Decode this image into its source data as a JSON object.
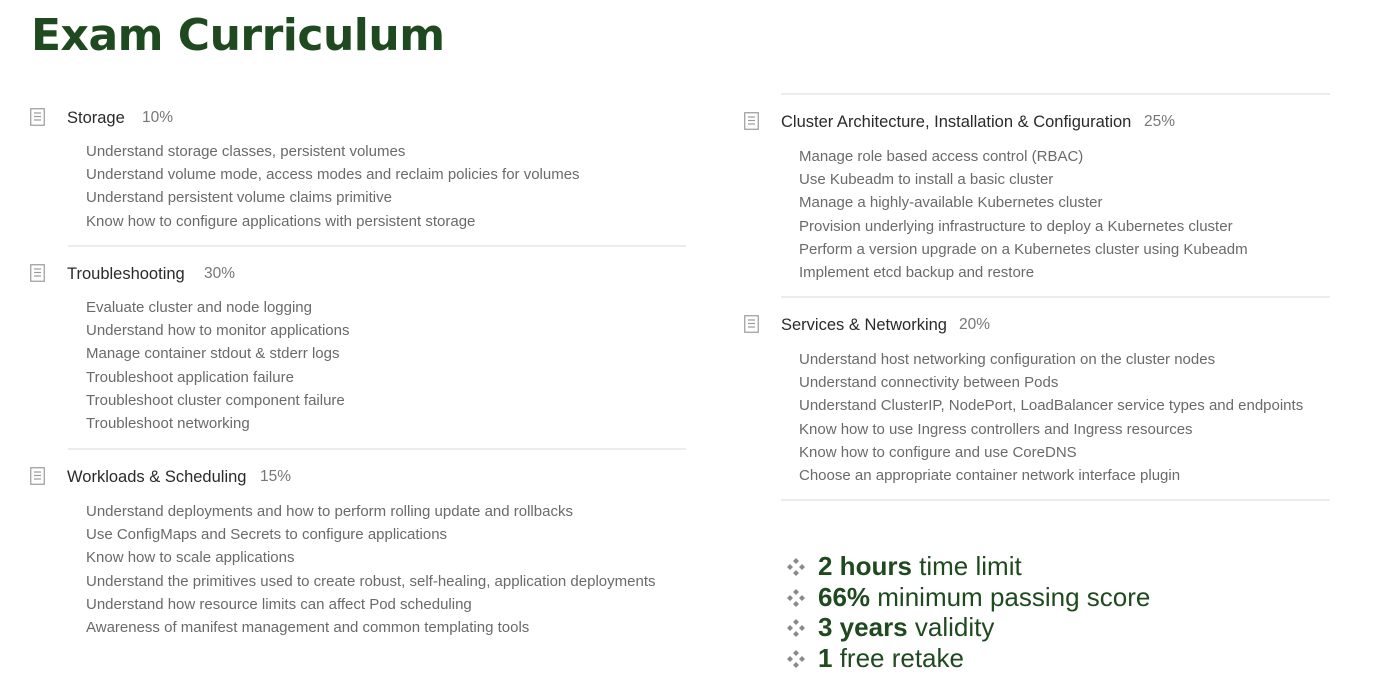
{
  "title": "Exam Curriculum",
  "left_sections": [
    {
      "title": "Storage",
      "weight": "10%",
      "items": [
        "Understand storage classes, persistent volumes",
        "Understand volume mode, access modes and reclaim policies for volumes",
        "Understand persistent volume claims primitive",
        "Know how to configure applications with persistent storage"
      ]
    },
    {
      "title": "Troubleshooting",
      "weight": "30%",
      "items": [
        "Evaluate cluster and node logging",
        "Understand how to monitor applications",
        "Manage container stdout & stderr logs",
        "Troubleshoot application failure",
        "Troubleshoot cluster component failure",
        "Troubleshoot networking"
      ]
    },
    {
      "title": "Workloads & Scheduling",
      "weight": "15%",
      "items": [
        "Understand deployments and how to perform rolling update and rollbacks",
        "Use ConfigMaps and Secrets to configure applications",
        "Know how to scale applications",
        "Understand the primitives used to create robust, self-healing, application deployments",
        "Understand how resource limits can affect Pod scheduling",
        "Awareness of manifest management and common templating tools"
      ]
    }
  ],
  "right_sections": [
    {
      "title": "Cluster Architecture, Installation & Configuration",
      "weight": "25%",
      "items": [
        "Manage role based access control (RBAC)",
        "Use Kubeadm to install a basic cluster",
        "Manage a highly-available Kubernetes cluster",
        "Provision underlying infrastructure to deploy a Kubernetes cluster",
        "Perform a version upgrade on a Kubernetes cluster using Kubeadm",
        "Implement etcd backup and restore"
      ]
    },
    {
      "title": "Services & Networking",
      "weight": "20%",
      "items": [
        "Understand host networking configuration on the cluster nodes",
        "Understand connectivity between Pods",
        "Understand ClusterIP, NodePort, LoadBalancer service types and endpoints",
        "Know how to use Ingress controllers and Ingress resources",
        "Know how to configure and use CoreDNS",
        "Choose an appropriate container network interface plugin"
      ]
    }
  ],
  "facts": [
    {
      "strong": "2 hours",
      "rest": " time limit"
    },
    {
      "strong": "66%",
      "rest": " minimum passing score"
    },
    {
      "strong": "3 years",
      "rest": " validity"
    },
    {
      "strong": "1",
      "rest": " free retake"
    }
  ],
  "icons": {
    "section": "document-icon",
    "fact": "four-diamond-bullet-icon"
  },
  "colors": {
    "title": "#1f4a1f",
    "section_title": "#2a2a2a",
    "weight": "#777777",
    "item": "#6a6a6a",
    "divider": "#ececec"
  }
}
